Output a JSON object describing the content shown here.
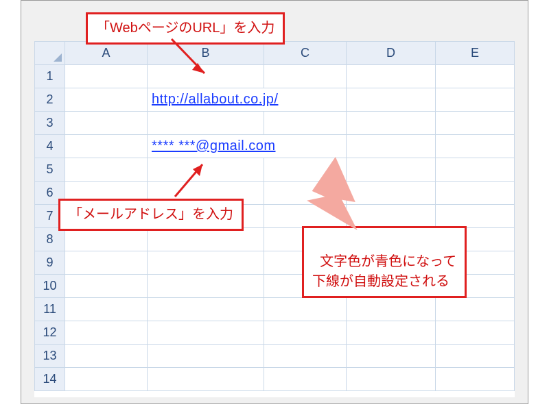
{
  "columns": [
    "A",
    "B",
    "C",
    "D",
    "E"
  ],
  "rows": [
    "1",
    "2",
    "3",
    "4",
    "5",
    "6",
    "7",
    "8",
    "9",
    "10",
    "11",
    "12",
    "13",
    "14"
  ],
  "cells": {
    "b2": "http://allabout.co.jp/",
    "b4": "**** ***@gmail.com"
  },
  "callouts": {
    "url_label": "「WebページのURL」を入力",
    "mail_label": "「メールアドレス」を入力",
    "effect_label": "文字色が青色になって\n下線が自動設定される"
  },
  "colors": {
    "callout_border": "#e02020",
    "link": "#1a3cff"
  }
}
